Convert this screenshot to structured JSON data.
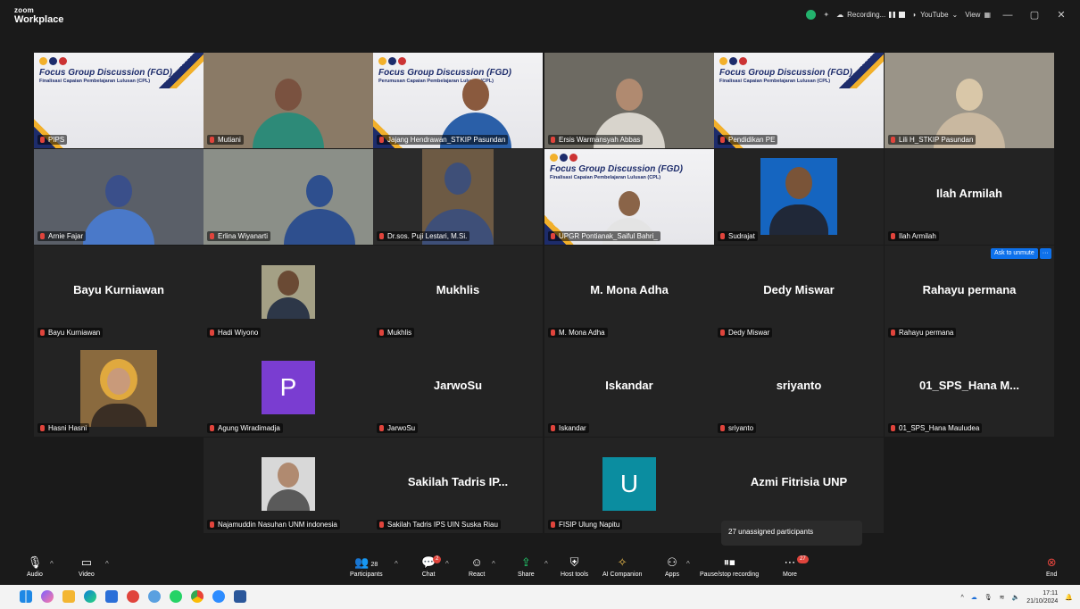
{
  "titlebar": {
    "brand_top": "zoom",
    "brand_bottom": "Workplace",
    "recording_label": "Recording...",
    "youtube_label": "YouTube",
    "view_label": "View",
    "minimize": "—",
    "maximize": "▢",
    "close": "✕"
  },
  "slide_text": {
    "fgd": "Focus Group Discussion (FGD)",
    "sub_final": "Finalisasi Capaian Pembelajaran Lulusan (CPL)",
    "sub_rumus": "Perumusan Capaian Pembelajaran Lulusan (CPL)"
  },
  "tiles": [
    {
      "name": "PIPS"
    },
    {
      "name": "Mutiani"
    },
    {
      "name": "Jajang Hendrawan_STKIP Pasundan"
    },
    {
      "name": "Ersis Warmansyah Abbas"
    },
    {
      "name": "Pendidikan PE"
    },
    {
      "name": "Lili H_STKIP Pasundan"
    },
    {
      "name": "Arnie Fajar"
    },
    {
      "name": "Erlina Wiyanarti"
    },
    {
      "name": "Dr.sos. Puji Lestari, M.Si."
    },
    {
      "name": "UPGR Pontianak_Saiful Bahri_"
    },
    {
      "name": "Sudrajat"
    },
    {
      "name": "Ilah Armilah",
      "display": "Ilah Armilah"
    },
    {
      "name": "Bayu Kurniawan",
      "display": "Bayu Kurniawan"
    },
    {
      "name": "Hadi Wiyono"
    },
    {
      "name": "Mukhlis",
      "display": "Mukhlis"
    },
    {
      "name": "M. Mona Adha",
      "display": "M. Mona Adha"
    },
    {
      "name": "Dedy Miswar",
      "display": "Dedy Miswar"
    },
    {
      "name": "Rahayu permana",
      "display": "Rahayu permana"
    },
    {
      "name": "Hasni Hasni"
    },
    {
      "name": "Agung Wiradimadja",
      "letter": "P"
    },
    {
      "name": "JarwoSu",
      "display": "JarwoSu"
    },
    {
      "name": "Iskandar",
      "display": "Iskandar"
    },
    {
      "name": "sriyanto",
      "display": "sriyanto"
    },
    {
      "name": "01_SPS_Hana Mauludea",
      "display": "01_SPS_Hana M..."
    },
    {
      "name": "Najamuddin Nasuhan UNM indonesia"
    },
    {
      "name": "Sakilah Tadris IPS UIN Suska Riau",
      "display": "Sakilah Tadris IP..."
    },
    {
      "name": "FISIP Ulung Napitu",
      "letter": "U"
    },
    {
      "name": "",
      "display": "Azmi Fitrisia UNP"
    }
  ],
  "ask_unmute": "Ask to unmute",
  "ask_more": "···",
  "unassigned_text": "27 unassigned participants",
  "toolbar": {
    "audio": "Audio",
    "video": "Video",
    "participants": "Participants",
    "participants_count": "28",
    "chat": "Chat",
    "chat_badge": "2",
    "react": "React",
    "share": "Share",
    "host_tools": "Host tools",
    "ai_companion": "AI Companion",
    "apps": "Apps",
    "pause_recording": "Pause/stop recording",
    "more": "More",
    "more_badge": "27",
    "end": "End"
  },
  "taskbar": {
    "time": "17:11",
    "date": "21/10/2024"
  },
  "colors": {
    "accent_green": "#23d16f",
    "zoom_blue": "#0e71eb",
    "avatar_purple": "#7a3dd1",
    "avatar_teal": "#0b8da0",
    "end_red": "#e0443c"
  }
}
